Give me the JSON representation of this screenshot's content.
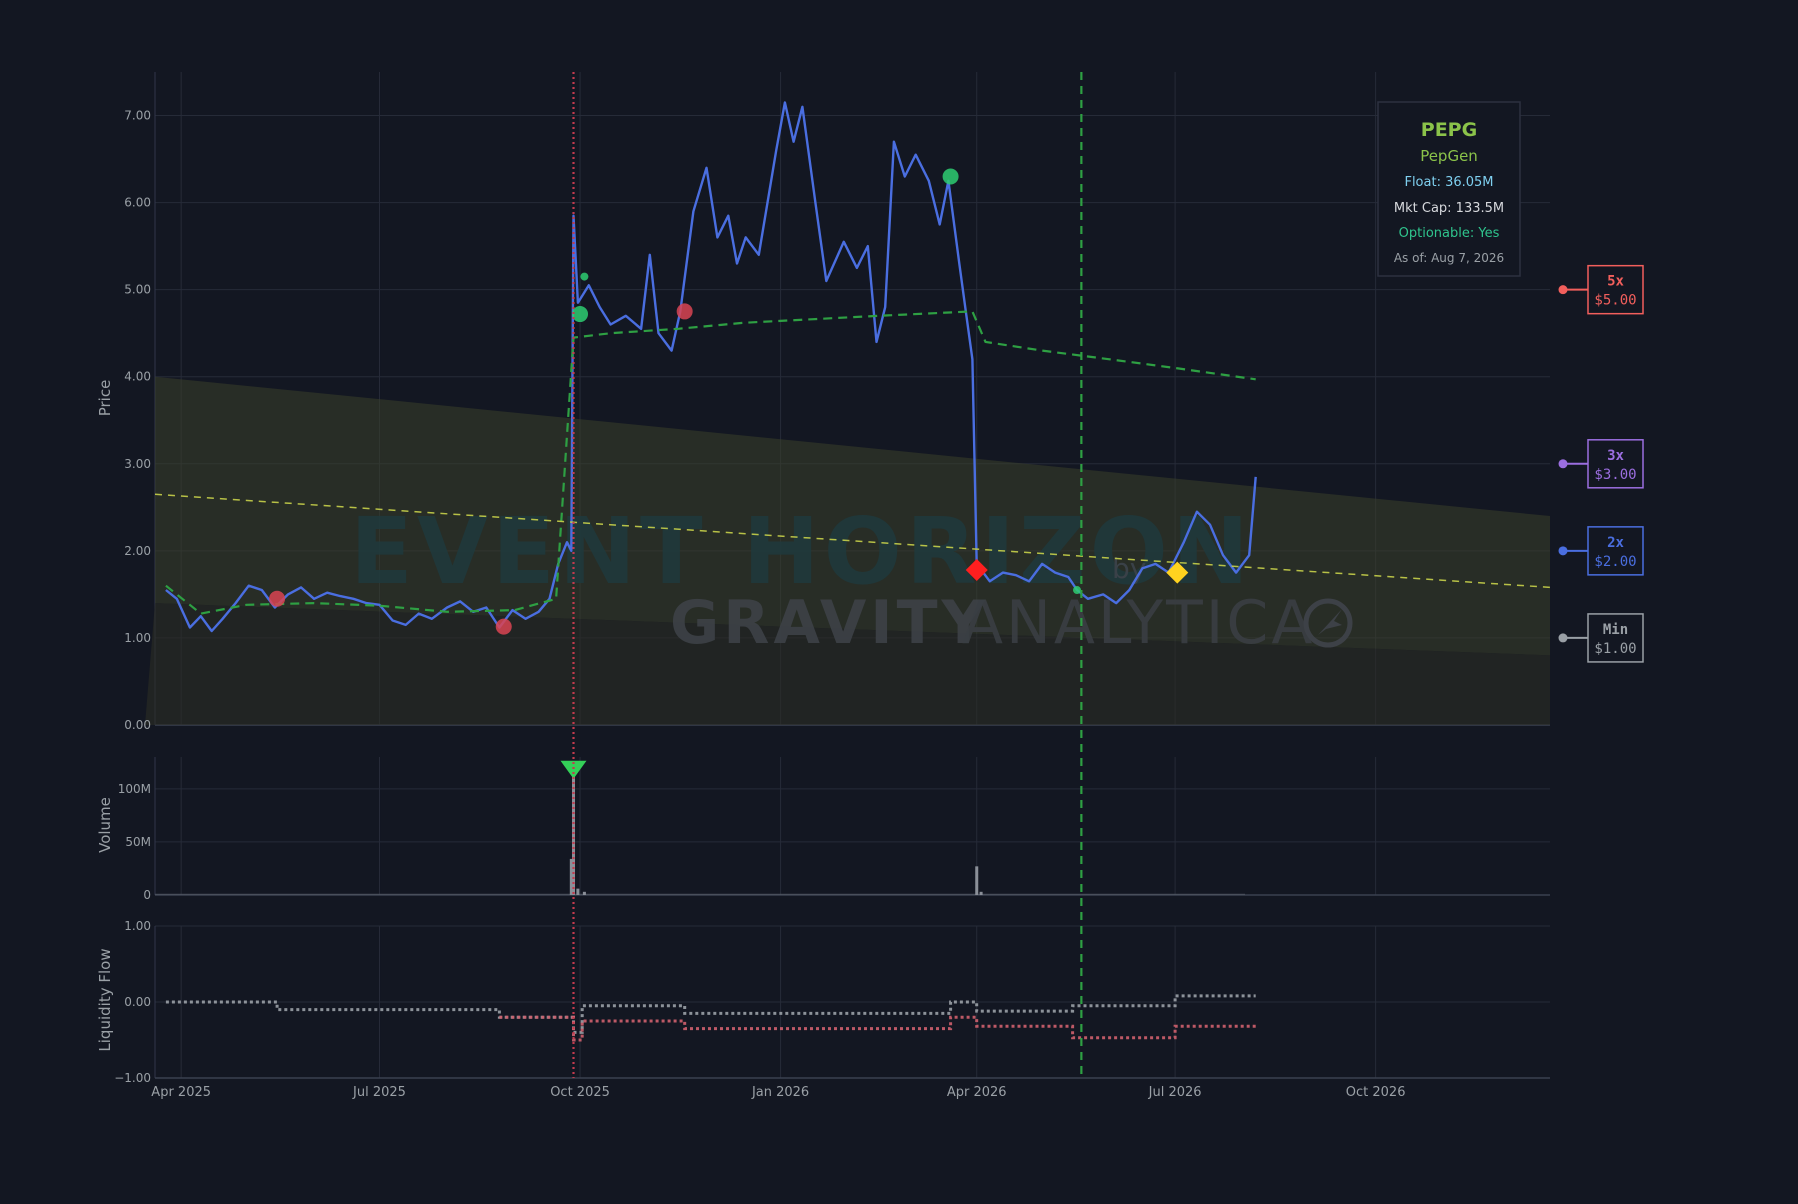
{
  "info_box": {
    "ticker": "PEPG",
    "company": "PepGen",
    "float": "Float: 36.05M",
    "mkt_cap": "Mkt Cap: 133.5M",
    "optionable": "Optionable: Yes",
    "as_of": "As of: Aug 7, 2026"
  },
  "watermark": {
    "line1": "EVENT HORIZON",
    "by": "by",
    "brand_bold": "GRAVITY",
    "brand_light": "ANALYTICA"
  },
  "targets": [
    {
      "label": "5x",
      "price": "$5.00",
      "value": 5.0,
      "color": "#f25f5c"
    },
    {
      "label": "3x",
      "price": "$3.00",
      "value": 3.0,
      "color": "#9b6ee0"
    },
    {
      "label": "2x",
      "price": "$2.00",
      "value": 2.0,
      "color": "#4a6ee0"
    },
    {
      "label": "Min",
      "price": "$1.00",
      "value": 1.0,
      "color": "#9aa0a6"
    }
  ],
  "colors": {
    "background": "#131722",
    "grid": "#262b38",
    "axis_text": "#9aa0a6",
    "price_line": "#4a6ee0",
    "ma_line": "#2ea043",
    "trend_line": "#c8d14a",
    "channel_fill": "#3a3f2a",
    "event_line": "#c23b4e",
    "liquidity_gray": "#9aa0a6",
    "liquidity_red": "#d0606e"
  },
  "chart_data": [
    {
      "type": "line",
      "panel": "price",
      "ylabel": "Price",
      "ylim": [
        0,
        7.5
      ],
      "yticks": [
        "0.00",
        "1.00",
        "2.00",
        "3.00",
        "4.00",
        "5.00",
        "6.00",
        "7.00"
      ],
      "xlim": [
        "2025-03-20",
        "2026-12-20"
      ],
      "xticks": [
        "Apr 2025",
        "Jul 2025",
        "Oct 2025",
        "Jan 2026",
        "Apr 2026",
        "Jul 2026",
        "Oct 2026"
      ],
      "grid": true,
      "series": [
        {
          "key": "price",
          "style": "solid",
          "points": [
            [
              "2025-03-25",
              1.55
            ],
            [
              "2025-03-30",
              1.45
            ],
            [
              "2025-04-05",
              1.12
            ],
            [
              "2025-04-10",
              1.25
            ],
            [
              "2025-04-15",
              1.08
            ],
            [
              "2025-04-20",
              1.22
            ],
            [
              "2025-04-26",
              1.4
            ],
            [
              "2025-05-02",
              1.6
            ],
            [
              "2025-05-08",
              1.55
            ],
            [
              "2025-05-14",
              1.35
            ],
            [
              "2025-05-20",
              1.5
            ],
            [
              "2025-05-26",
              1.58
            ],
            [
              "2025-06-01",
              1.45
            ],
            [
              "2025-06-07",
              1.52
            ],
            [
              "2025-06-13",
              1.48
            ],
            [
              "2025-06-19",
              1.45
            ],
            [
              "2025-06-25",
              1.4
            ],
            [
              "2025-07-01",
              1.38
            ],
            [
              "2025-07-07",
              1.2
            ],
            [
              "2025-07-13",
              1.15
            ],
            [
              "2025-07-19",
              1.28
            ],
            [
              "2025-07-25",
              1.22
            ],
            [
              "2025-08-01",
              1.35
            ],
            [
              "2025-08-07",
              1.42
            ],
            [
              "2025-08-13",
              1.3
            ],
            [
              "2025-08-19",
              1.35
            ],
            [
              "2025-08-25",
              1.12
            ],
            [
              "2025-08-31",
              1.32
            ],
            [
              "2025-09-06",
              1.22
            ],
            [
              "2025-09-12",
              1.3
            ],
            [
              "2025-09-17",
              1.45
            ],
            [
              "2025-09-21",
              1.85
            ],
            [
              "2025-09-25",
              2.1
            ],
            [
              "2025-09-27",
              2.0
            ],
            [
              "2025-09-28",
              5.85
            ],
            [
              "2025-09-30",
              4.85
            ],
            [
              "2025-10-05",
              5.05
            ],
            [
              "2025-10-10",
              4.8
            ],
            [
              "2025-10-15",
              4.6
            ],
            [
              "2025-10-22",
              4.7
            ],
            [
              "2025-10-29",
              4.55
            ],
            [
              "2025-11-02",
              5.4
            ],
            [
              "2025-11-06",
              4.5
            ],
            [
              "2025-11-12",
              4.3
            ],
            [
              "2025-11-16",
              4.75
            ],
            [
              "2025-11-22",
              5.9
            ],
            [
              "2025-11-28",
              6.4
            ],
            [
              "2025-12-03",
              5.6
            ],
            [
              "2025-12-08",
              5.85
            ],
            [
              "2025-12-12",
              5.3
            ],
            [
              "2025-12-16",
              5.6
            ],
            [
              "2025-12-22",
              5.4
            ],
            [
              "2025-12-30",
              6.6
            ],
            [
              "2026-01-03",
              7.15
            ],
            [
              "2026-01-07",
              6.7
            ],
            [
              "2026-01-11",
              7.1
            ],
            [
              "2026-01-17",
              6.0
            ],
            [
              "2026-01-22",
              5.1
            ],
            [
              "2026-01-30",
              5.55
            ],
            [
              "2026-02-05",
              5.25
            ],
            [
              "2026-02-10",
              5.5
            ],
            [
              "2026-02-14",
              4.4
            ],
            [
              "2026-02-18",
              4.8
            ],
            [
              "2026-02-22",
              6.7
            ],
            [
              "2026-02-27",
              6.3
            ],
            [
              "2026-03-04",
              6.55
            ],
            [
              "2026-03-10",
              6.25
            ],
            [
              "2026-03-15",
              5.75
            ],
            [
              "2026-03-19",
              6.25
            ],
            [
              "2026-03-24",
              5.3
            ],
            [
              "2026-03-27",
              4.75
            ],
            [
              "2026-03-30",
              4.2
            ],
            [
              "2026-04-01",
              1.85
            ],
            [
              "2026-04-07",
              1.65
            ],
            [
              "2026-04-13",
              1.75
            ],
            [
              "2026-04-19",
              1.72
            ],
            [
              "2026-04-25",
              1.65
            ],
            [
              "2026-05-01",
              1.85
            ],
            [
              "2026-05-07",
              1.75
            ],
            [
              "2026-05-13",
              1.7
            ],
            [
              "2026-05-17",
              1.55
            ],
            [
              "2026-05-22",
              1.45
            ],
            [
              "2026-05-29",
              1.5
            ],
            [
              "2026-06-04",
              1.4
            ],
            [
              "2026-06-10",
              1.55
            ],
            [
              "2026-06-16",
              1.8
            ],
            [
              "2026-06-22",
              1.85
            ],
            [
              "2026-06-28",
              1.75
            ],
            [
              "2026-07-05",
              2.1
            ],
            [
              "2026-07-11",
              2.45
            ],
            [
              "2026-07-17",
              2.3
            ],
            [
              "2026-07-23",
              1.95
            ],
            [
              "2026-07-29",
              1.75
            ],
            [
              "2026-08-04",
              1.95
            ],
            [
              "2026-08-07",
              2.85
            ]
          ]
        },
        {
          "key": "moving_average",
          "style": "dashed",
          "points": [
            [
              "2025-03-25",
              1.6
            ],
            [
              "2025-04-10",
              1.28
            ],
            [
              "2025-05-01",
              1.38
            ],
            [
              "2025-06-01",
              1.4
            ],
            [
              "2025-07-01",
              1.37
            ],
            [
              "2025-08-01",
              1.3
            ],
            [
              "2025-09-01",
              1.32
            ],
            [
              "2025-09-20",
              1.45
            ],
            [
              "2025-09-28",
              4.45
            ],
            [
              "2025-10-15",
              4.5
            ],
            [
              "2025-11-15",
              4.55
            ],
            [
              "2025-12-15",
              4.62
            ],
            [
              "2026-01-15",
              4.66
            ],
            [
              "2026-02-15",
              4.7
            ],
            [
              "2026-03-30",
              4.75
            ],
            [
              "2026-04-05",
              4.4
            ],
            [
              "2026-05-01",
              4.3
            ],
            [
              "2026-06-01",
              4.2
            ],
            [
              "2026-07-01",
              4.1
            ],
            [
              "2026-08-07",
              3.97
            ]
          ]
        },
        {
          "key": "trend",
          "style": "dashed",
          "points": [
            [
              "2025-03-20",
              2.65
            ],
            [
              "2026-12-20",
              1.58
            ]
          ]
        }
      ],
      "channel": {
        "upper": [
          [
            "2025-03-20",
            4.0
          ],
          [
            "2026-12-20",
            2.4
          ]
        ],
        "lower": [
          [
            "2025-03-20",
            1.4
          ],
          [
            "2026-12-20",
            0.8
          ]
        ]
      },
      "markers": [
        {
          "date": "2025-10-01",
          "value": 4.72,
          "shape": "circle",
          "color": "#2ecc71",
          "size": "large"
        },
        {
          "date": "2025-10-03",
          "value": 5.15,
          "shape": "circle",
          "color": "#2ecc71",
          "size": "small"
        },
        {
          "date": "2025-11-18",
          "value": 4.75,
          "shape": "circle",
          "color": "#d94452",
          "size": "large"
        },
        {
          "date": "2025-05-15",
          "value": 1.45,
          "shape": "circle",
          "color": "#d94452",
          "size": "large"
        },
        {
          "date": "2025-08-27",
          "value": 1.13,
          "shape": "circle",
          "color": "#d94452",
          "size": "large"
        },
        {
          "date": "2026-03-20",
          "value": 6.3,
          "shape": "circle",
          "color": "#2ecc71",
          "size": "large"
        },
        {
          "date": "2026-04-01",
          "value": 1.78,
          "shape": "diamond",
          "color": "#ff1f1f",
          "size": "large"
        },
        {
          "date": "2026-05-17",
          "value": 1.55,
          "shape": "circle",
          "color": "#2ecc71",
          "size": "small"
        },
        {
          "date": "2026-07-02",
          "value": 1.75,
          "shape": "diamond",
          "color": "#ffd21f",
          "size": "large"
        }
      ],
      "vlines": [
        {
          "date": "2025-09-28",
          "style": "dotted",
          "color": "#c23b4e"
        },
        {
          "date": "2026-05-19",
          "style": "dashed",
          "color": "#2ea043"
        }
      ]
    },
    {
      "type": "bar",
      "panel": "volume",
      "ylabel": "Volume",
      "ylim": [
        0,
        130
      ],
      "yticks": [
        "0",
        "50M",
        "100M"
      ],
      "bars": [
        [
          "2025-09-27",
          34
        ],
        [
          "2025-09-28",
          118
        ],
        [
          "2025-09-30",
          6
        ],
        [
          "2025-10-03",
          3
        ],
        [
          "2026-04-01",
          27
        ],
        [
          "2026-04-03",
          3
        ]
      ],
      "baseline_value": 1.2,
      "marker": {
        "date": "2025-09-28",
        "value": 118,
        "shape": "triangle-down",
        "color": "#34d058"
      }
    },
    {
      "type": "line",
      "panel": "liquidity",
      "ylabel": "Liquidity Flow",
      "ylim": [
        -1.0,
        1.0
      ],
      "yticks": [
        "−1.00",
        "0.00",
        "1.00"
      ],
      "series": [
        {
          "key": "gray_flow",
          "style": "stepped",
          "points": [
            [
              "2025-03-25",
              0.0
            ],
            [
              "2025-05-15",
              0.0
            ],
            [
              "2025-05-15",
              -0.1
            ],
            [
              "2025-08-25",
              -0.1
            ],
            [
              "2025-08-25",
              -0.2
            ],
            [
              "2025-09-28",
              -0.2
            ],
            [
              "2025-09-28",
              -0.4
            ],
            [
              "2025-10-02",
              -0.4
            ],
            [
              "2025-10-02",
              -0.05
            ],
            [
              "2025-11-18",
              -0.05
            ],
            [
              "2025-11-18",
              -0.15
            ],
            [
              "2026-03-20",
              -0.15
            ],
            [
              "2026-03-20",
              0.0
            ],
            [
              "2026-04-01",
              0.0
            ],
            [
              "2026-04-01",
              -0.12
            ],
            [
              "2026-05-15",
              -0.12
            ],
            [
              "2026-05-15",
              -0.05
            ],
            [
              "2026-07-01",
              -0.05
            ],
            [
              "2026-07-01",
              0.08
            ],
            [
              "2026-08-07",
              0.08
            ]
          ]
        },
        {
          "key": "red_flow",
          "style": "stepped",
          "points": [
            [
              "2025-08-25",
              -0.2
            ],
            [
              "2025-09-28",
              -0.2
            ],
            [
              "2025-09-28",
              -0.5
            ],
            [
              "2025-10-02",
              -0.5
            ],
            [
              "2025-10-02",
              -0.25
            ],
            [
              "2025-11-18",
              -0.25
            ],
            [
              "2025-11-18",
              -0.35
            ],
            [
              "2026-03-20",
              -0.35
            ],
            [
              "2026-03-20",
              -0.2
            ],
            [
              "2026-04-01",
              -0.2
            ],
            [
              "2026-04-01",
              -0.32
            ],
            [
              "2026-05-15",
              -0.32
            ],
            [
              "2026-05-15",
              -0.47
            ],
            [
              "2026-07-01",
              -0.47
            ],
            [
              "2026-07-01",
              -0.32
            ],
            [
              "2026-08-07",
              -0.32
            ]
          ]
        }
      ]
    }
  ]
}
